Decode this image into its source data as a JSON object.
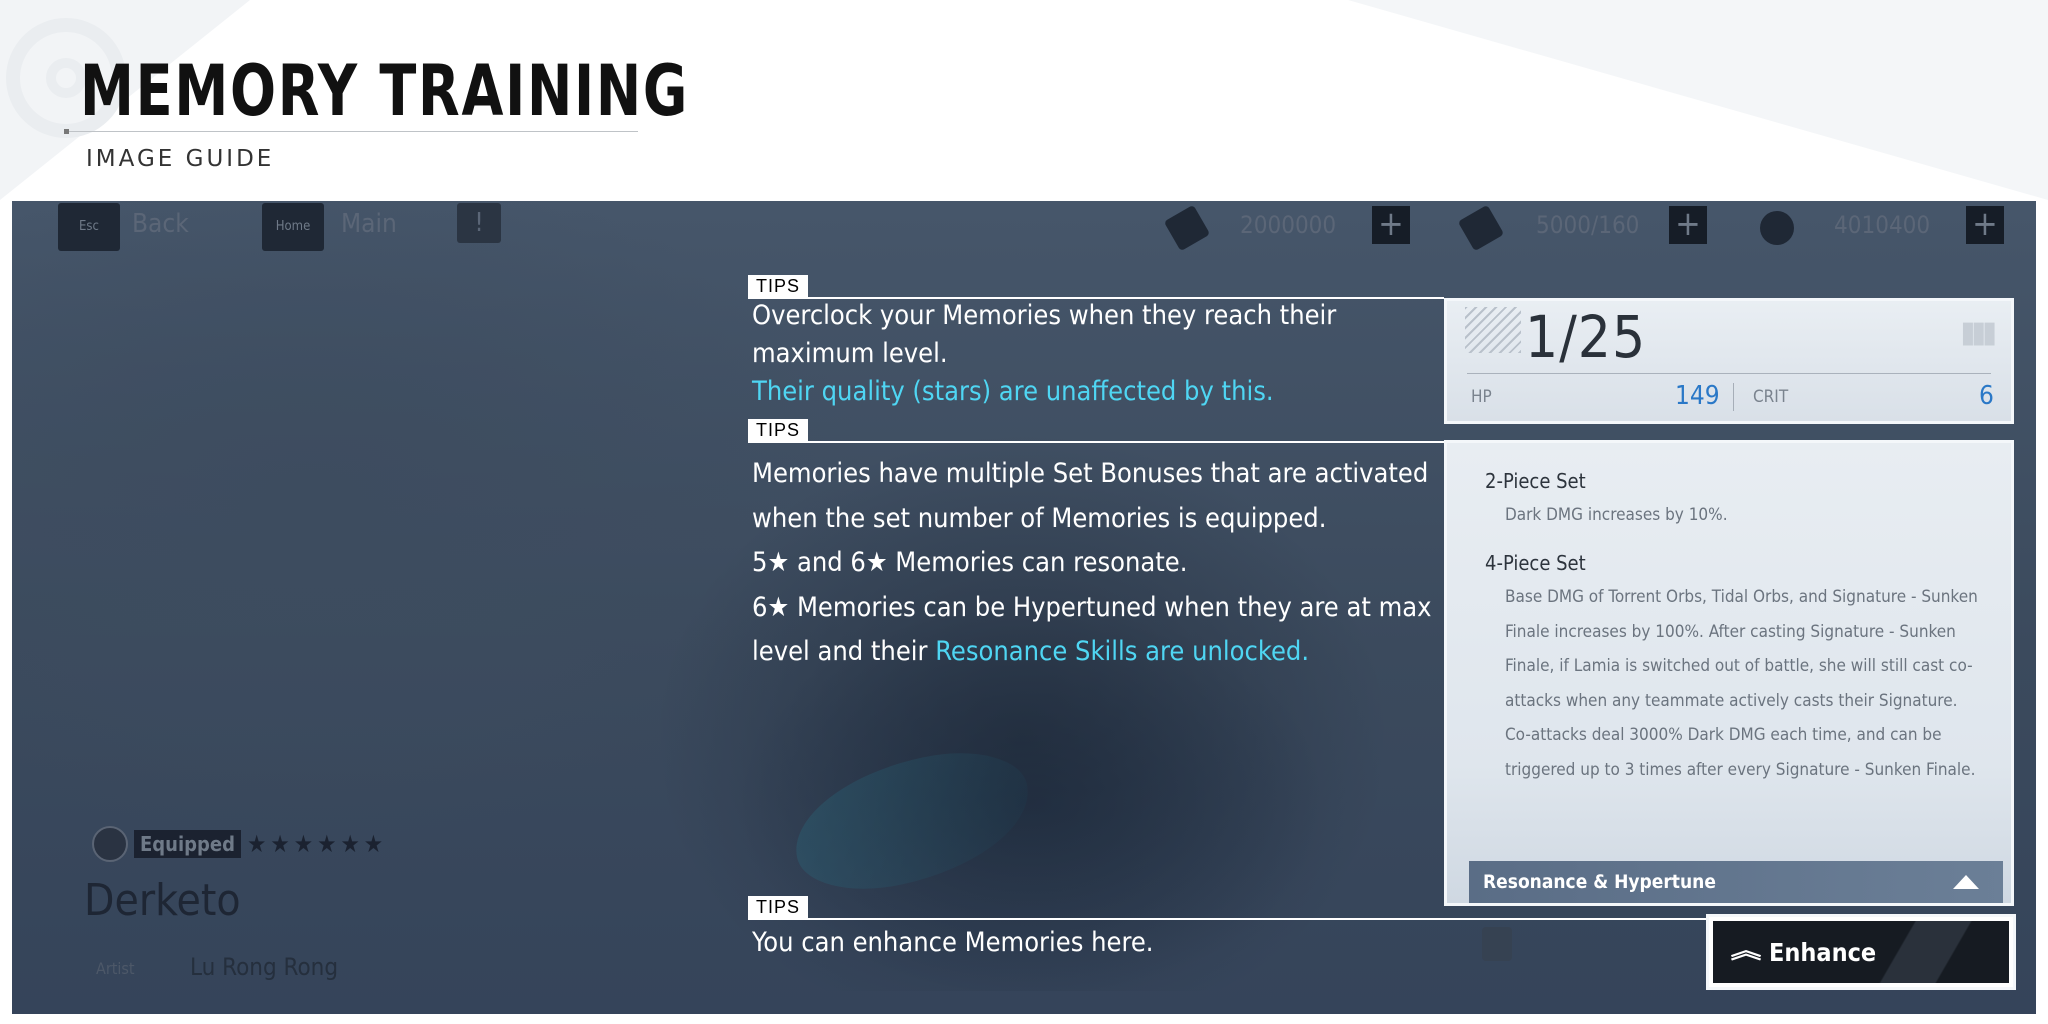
{
  "header": {
    "title": "MEMORY TRAINING",
    "subtitle": "IMAGE GUIDE"
  },
  "topbar": {
    "esc_key": "Esc",
    "back_label": "Back",
    "home_key": "Home",
    "main_label": "Main",
    "info_icon": "!",
    "resources": [
      {
        "icon": "ticket-icon",
        "value": "2000000",
        "plus": "+"
      },
      {
        "icon": "stamina-icon",
        "value": "5000/160",
        "plus": "+"
      },
      {
        "icon": "coin-icon",
        "value": "4010400",
        "plus": "+"
      }
    ]
  },
  "character": {
    "equipped_label": "Equipped",
    "stars": "★★★★★★",
    "name": "Derketo",
    "artist_label": "Artist",
    "artist_name": "Lu Rong Rong"
  },
  "tips": [
    {
      "tag": "TIPS",
      "lines": [
        "Overclock your Memories when they reach their",
        "maximum level."
      ],
      "highlight": "Their quality (stars) are unaffected by this."
    },
    {
      "tag": "TIPS",
      "lines": [
        "Memories have multiple Set Bonuses that are activated",
        "when the set number of Memories is equipped.",
        "5★ and 6★ Memories can resonate.",
        "6★ Memories can be Hypertuned when they are at max"
      ],
      "last_prefix": "level and their ",
      "highlight": "Resonance Skills are unlocked."
    },
    {
      "tag": "TIPS",
      "lines": [
        "You can enhance Memories here."
      ]
    }
  ],
  "level_panel": {
    "level": "1/25",
    "hp_label": "HP",
    "hp_value": "149",
    "crit_label": "CRIT",
    "crit_value": "6"
  },
  "set_panel": {
    "two_piece_title": "2-Piece Set",
    "two_piece_desc": "Dark DMG increases by 10%.",
    "four_piece_title": "4-Piece Set",
    "four_piece_desc": "Base DMG of Torrent Orbs, Tidal Orbs, and Signature - Sunken Finale increases by 100%. After casting Signature - Sunken Finale, if Lamia is switched out of battle, she will still cast co-attacks when any teammate actively casts their Signature. Co-attacks deal 3000% Dark DMG each time, and can be triggered up to 3 times after every Signature - Sunken Finale.",
    "resonance_label": "Resonance & Hypertune"
  },
  "enhance_button": {
    "label": "Enhance",
    "icon": "double-chevron-up-icon"
  }
}
